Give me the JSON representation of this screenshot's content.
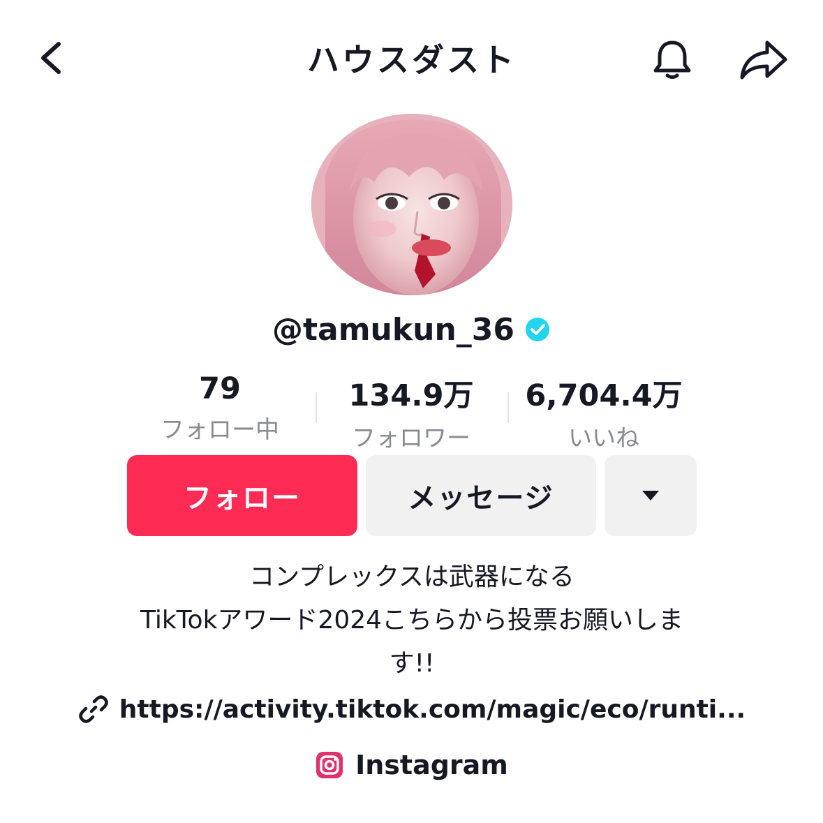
{
  "header": {
    "title": "ハウスダスト",
    "back_icon": "chevron-left-icon",
    "bell_icon": "bell-icon",
    "share_icon": "share-arrow-icon"
  },
  "profile": {
    "avatar": "profile-photo",
    "username": "@tamukun_36",
    "verified": true,
    "verified_color": "#20d5ec"
  },
  "stats": {
    "following": {
      "value": "79",
      "label": "フォロー中"
    },
    "followers": {
      "value": "134.9万",
      "label": "フォロワー"
    },
    "likes": {
      "value": "6,704.4万",
      "label": "いいね"
    }
  },
  "actions": {
    "follow_label": "フォロー",
    "follow_color": "#fe2c55",
    "message_label": "メッセージ",
    "more_icon": "caret-down-icon"
  },
  "bio": {
    "lines": [
      "コンプレックスは武器になる",
      "TikTokアワード2024こちらから投票お願いしま",
      "す!!"
    ],
    "link": "https://activity.tiktok.com/magic/eco/runti...",
    "link_icon": "link-icon",
    "instagram_label": "Instagram",
    "instagram_icon": "instagram-icon",
    "instagram_color": "#e1306c"
  }
}
